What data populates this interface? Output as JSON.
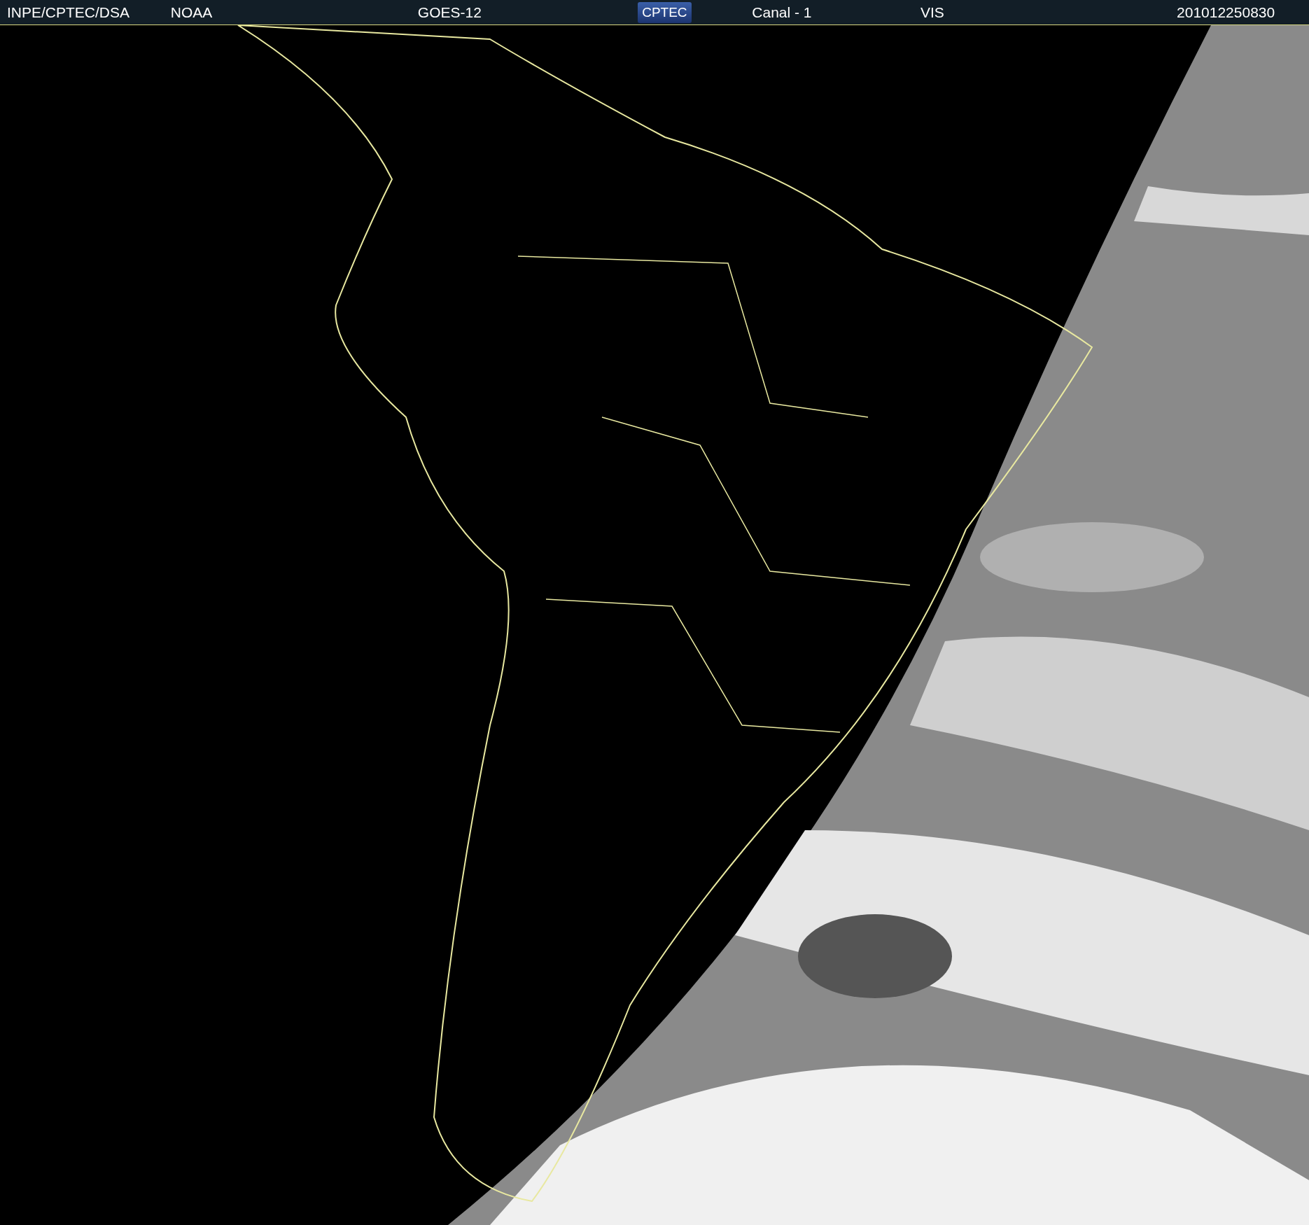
{
  "header": {
    "items": [
      {
        "kind": "text",
        "text": "INPE/CPTEC/DSA"
      },
      {
        "kind": "text",
        "text": "NOAA"
      },
      {
        "kind": "text",
        "text": "GOES-12"
      },
      {
        "kind": "logo",
        "text": "CPTEC"
      },
      {
        "kind": "text",
        "text": "Canal - 1"
      },
      {
        "kind": "text",
        "text": "VIS"
      },
      {
        "kind": "text",
        "text": "201012250830"
      }
    ]
  }
}
